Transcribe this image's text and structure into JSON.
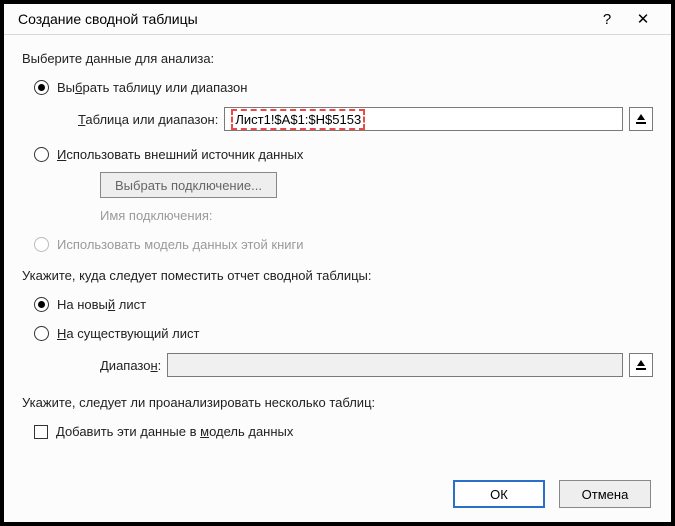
{
  "titlebar": {
    "title": "Создание сводной таблицы",
    "help": "?",
    "close": "✕"
  },
  "section1": {
    "heading": "Выберите данные для анализа:",
    "opt_range": {
      "pre": "Вы",
      "u": "б",
      "post": "рать таблицу или диапазон"
    },
    "range_label": {
      "u": "Т",
      "post": "аблица или диапазон:"
    },
    "range_value": "Лист1!$A$1:$H$5153",
    "opt_external": {
      "u": "И",
      "post": "спользовать внешний источник данных"
    },
    "choose_conn_btn": "Выбрать подключение...",
    "conn_name_label": "Имя подключения:",
    "opt_model": "Использовать модель данных этой книги"
  },
  "section2": {
    "heading": "Укажите, куда следует поместить отчет сводной таблицы:",
    "opt_new": {
      "pre": "На новы",
      "u": "й",
      "post": " лист"
    },
    "opt_existing": {
      "u": "Н",
      "post": "а существующий лист"
    },
    "range_label": {
      "pre": "Диапазо",
      "u": "н",
      "post": ":"
    }
  },
  "section3": {
    "heading": "Укажите, следует ли проанализировать несколько таблиц:",
    "chk_label": {
      "pre": "Добавить эти данные в ",
      "u": "м",
      "post": "одель данных"
    }
  },
  "footer": {
    "ok": "ОК",
    "cancel": "Отмена"
  }
}
